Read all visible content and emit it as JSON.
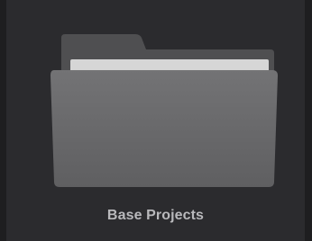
{
  "project_tile": {
    "label": "Base Projects",
    "icon": "folder-icon"
  },
  "colors": {
    "page_background": "#1e1e20",
    "tile_background": "#2b2b2e",
    "folder_back": "#4f4f51",
    "folder_paper": "#d6d6d6",
    "folder_front": "#6a6a6c",
    "label_text": "#b9b9bc"
  }
}
